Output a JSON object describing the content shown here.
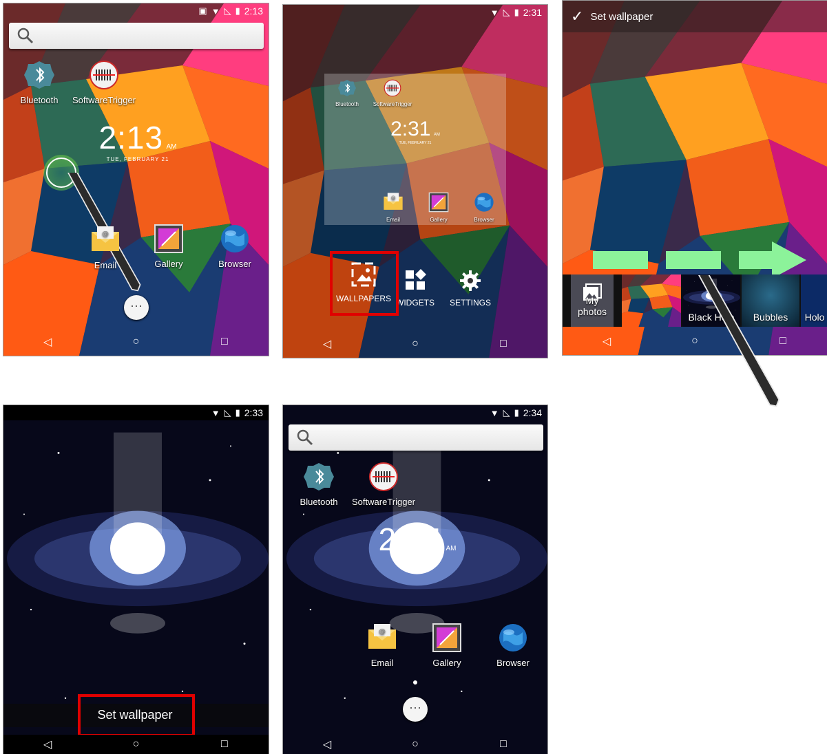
{
  "panel1": {
    "status_time": "2:13",
    "apps_top": [
      "Bluetooth",
      "SoftwareTrigger"
    ],
    "clock": {
      "time": "2:13",
      "ampm": "AM",
      "date": "TUE, FEBRUARY 21"
    },
    "apps_bottom": [
      "Email",
      "Gallery",
      "Browser"
    ]
  },
  "panel2": {
    "status_time": "2:31",
    "preview_apps_top": [
      "Bluetooth",
      "SoftwareTrigger"
    ],
    "preview_clock": {
      "time": "2:31",
      "ampm": "AM",
      "date": "TUE, FEBRUARY 21"
    },
    "preview_apps_bottom": [
      "Email",
      "Gallery",
      "Browser"
    ],
    "options": [
      "WALLPAPERS",
      "WIDGETS",
      "SETTINGS"
    ]
  },
  "panel3": {
    "action_label": "Set wallpaper",
    "wallpapers": [
      "My photos",
      "Black Hole",
      "Bubbles",
      "Holo"
    ]
  },
  "panel4": {
    "status_time": "2:33",
    "set_button": "Set wallpaper"
  },
  "panel5": {
    "status_time": "2:34",
    "apps_top": [
      "Bluetooth",
      "SoftwareTrigger"
    ],
    "clock": {
      "time": "2:34",
      "ampm": "AM"
    },
    "apps_bottom": [
      "Email",
      "Gallery",
      "Browser"
    ]
  },
  "colors": {
    "highlight": "#e00000",
    "arrow": "#8cf39a",
    "nav_bg": "#000000"
  }
}
